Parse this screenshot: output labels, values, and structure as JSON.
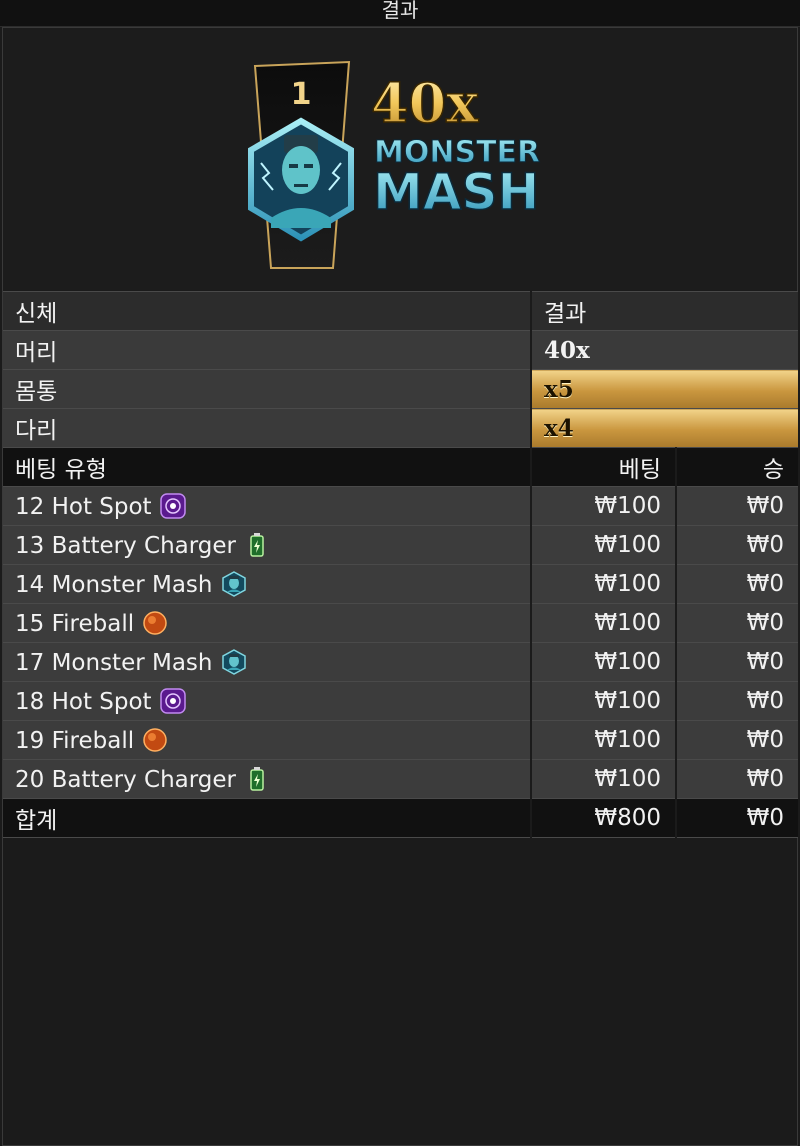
{
  "header": {
    "title": "결과"
  },
  "banner": {
    "position": "1",
    "multiplier": "40x",
    "name_top": "MONSTER",
    "name_bottom": "MASH"
  },
  "results": {
    "col_part": "신체",
    "col_result": "결과",
    "rows": [
      {
        "part": "머리",
        "value": "40x",
        "highlight": false
      },
      {
        "part": "몸통",
        "value": "x5",
        "highlight": true
      },
      {
        "part": "다리",
        "value": "x4",
        "highlight": true
      }
    ]
  },
  "bets": {
    "col_type": "베팅 유형",
    "col_bet": "베팅",
    "col_win": "승",
    "rows": [
      {
        "label": "12 Hot Spot",
        "icon": "hot-spot-icon",
        "bet": "₩100",
        "win": "₩0"
      },
      {
        "label": "13 Battery Charger",
        "icon": "battery-charger-icon",
        "bet": "₩100",
        "win": "₩0"
      },
      {
        "label": "14 Monster Mash",
        "icon": "monster-mash-icon",
        "bet": "₩100",
        "win": "₩0"
      },
      {
        "label": "15 Fireball",
        "icon": "fireball-icon",
        "bet": "₩100",
        "win": "₩0"
      },
      {
        "label": "17 Monster Mash",
        "icon": "monster-mash-icon",
        "bet": "₩100",
        "win": "₩0"
      },
      {
        "label": "18 Hot Spot",
        "icon": "hot-spot-icon",
        "bet": "₩100",
        "win": "₩0"
      },
      {
        "label": "19 Fireball",
        "icon": "fireball-icon",
        "bet": "₩100",
        "win": "₩0"
      },
      {
        "label": "20 Battery Charger",
        "icon": "battery-charger-icon",
        "bet": "₩100",
        "win": "₩0"
      }
    ],
    "total": {
      "label": "합계",
      "bet": "₩800",
      "win": "₩0"
    }
  },
  "colors": {
    "gold": "#c9963e",
    "teal": "#4ec3cf",
    "purple": "#8a3fc8",
    "fire": "#e0621e",
    "battery": "#3fae4a"
  }
}
